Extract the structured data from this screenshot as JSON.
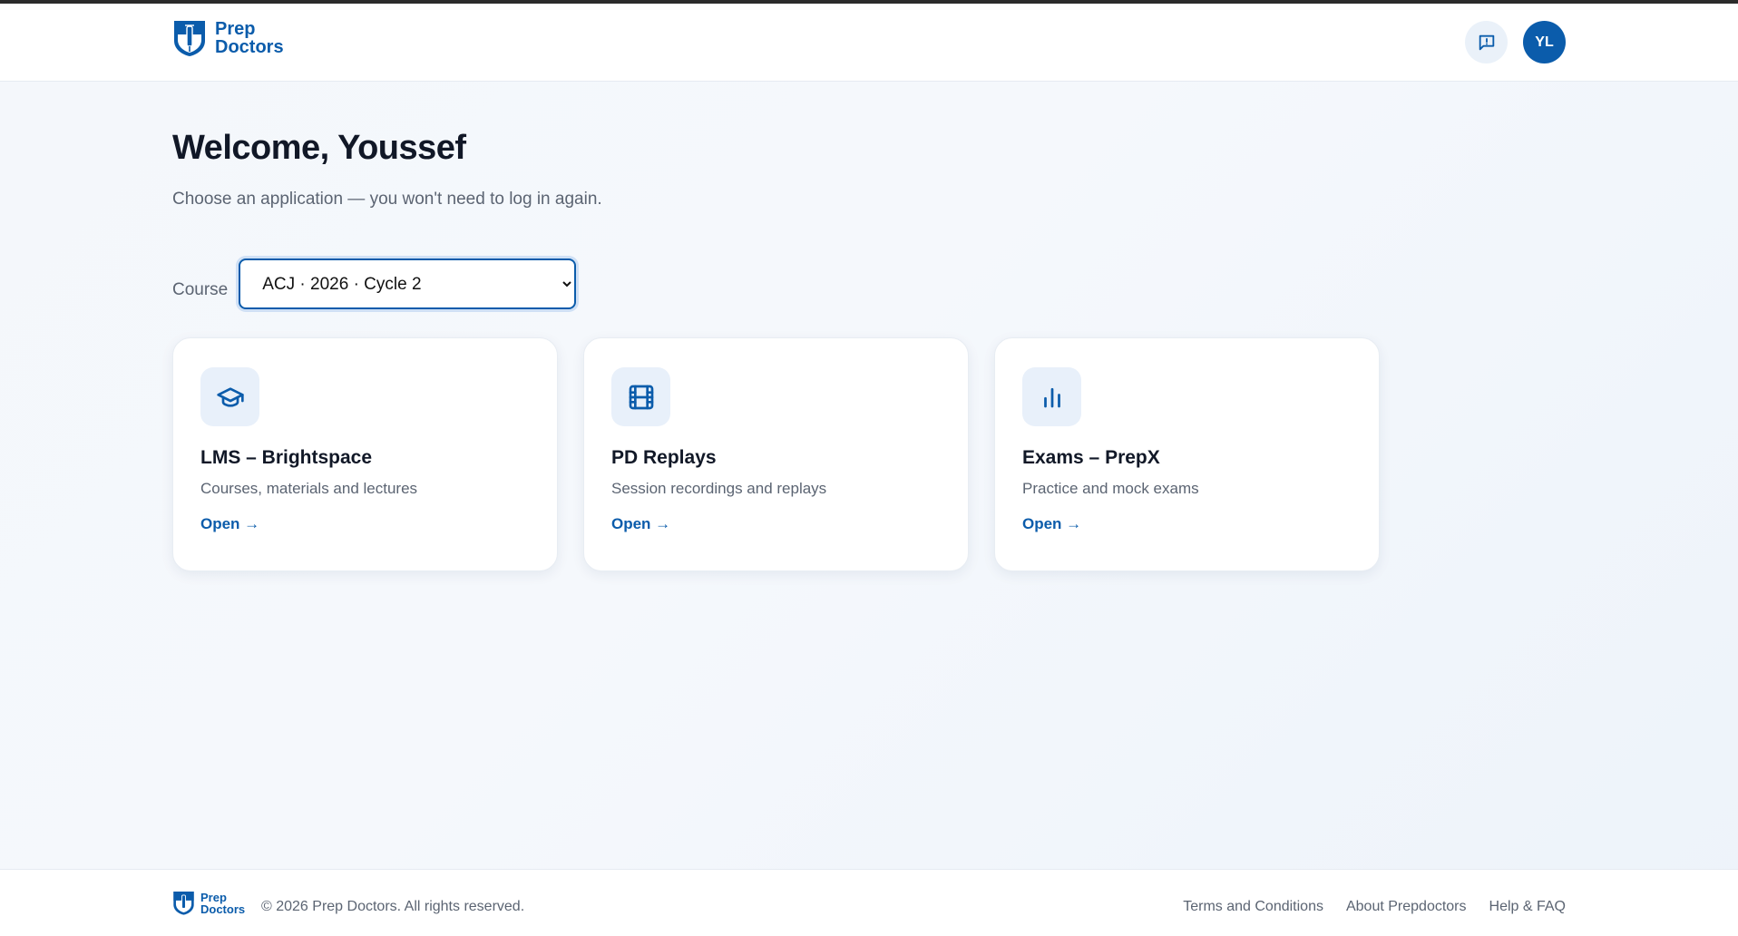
{
  "brand": {
    "name_line1": "Prep",
    "name_line2": "Doctors",
    "color": "#0b5cab"
  },
  "header": {
    "feedback_icon": "message-alert-icon",
    "avatar_initials": "YL"
  },
  "main": {
    "title": "Welcome, Youssef",
    "subtitle": "Choose an application — you won't need to log in again.",
    "course_label": "Course",
    "course_selected": "ACJ · 2026 · Cycle 2"
  },
  "cards": [
    {
      "icon": "graduation-cap-icon",
      "title": "LMS – Brightspace",
      "description": "Courses, materials and lectures",
      "open_label": "Open →"
    },
    {
      "icon": "film-icon",
      "title": "PD Replays",
      "description": "Session recordings and replays",
      "open_label": "Open →"
    },
    {
      "icon": "bar-chart-icon",
      "title": "Exams – PrepX",
      "description": "Practice and mock exams",
      "open_label": "Open →"
    }
  ],
  "footer": {
    "copyright": "© 2026 Prep Doctors. All rights reserved.",
    "links": [
      "Terms and Conditions",
      "About Prepdoctors",
      "Help & FAQ"
    ]
  }
}
